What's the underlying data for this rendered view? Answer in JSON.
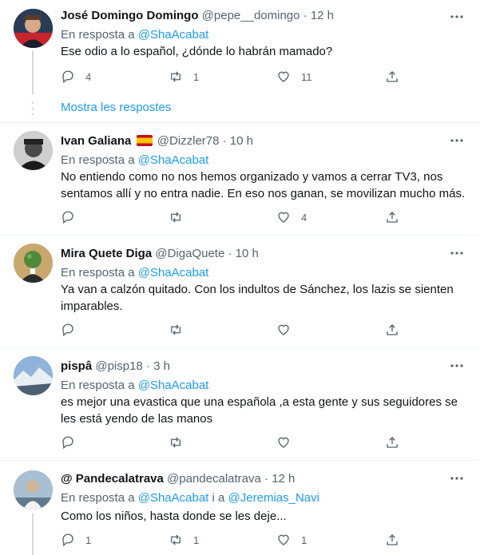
{
  "colors": {
    "link": "#1d9bf0",
    "muted": "#536471",
    "text": "#0f1419",
    "divider": "#eff3f4"
  },
  "show_replies_label": "Mostra les respostes",
  "tweets": [
    {
      "name": "José Domingo Domingo",
      "handle": "@pepe__domingo",
      "time": "· 12 h",
      "reply_prefix": "En resposta a",
      "reply_to": "@ShaAcabat",
      "reply_extra": "",
      "reply_to2": "",
      "text": "Ese odio a lo español, ¿dónde lo habrán mamado?",
      "replies": "4",
      "retweets": "1",
      "likes": "11",
      "avatar_icon": "avatar-photo-man-red"
    },
    {
      "name": "Ivan Galiana",
      "flag": "spain-flag-emoji",
      "handle": "@Dizzler78",
      "time": "· 10 h",
      "reply_prefix": "En resposta a",
      "reply_to": "@ShaAcabat",
      "text": "No entiendo como no nos hemos organizado y vamos a cerrar TV3, nos sentamos allí y no entra nadie. En eso nos ganan, se movilizan mucho más.",
      "replies": "",
      "retweets": "",
      "likes": "4",
      "avatar_icon": "avatar-photo-man-bw"
    },
    {
      "name": "Mira Quete Diga",
      "handle": "@DigaQuete",
      "time": "· 10 h",
      "reply_prefix": "En resposta a",
      "reply_to": "@ShaAcabat",
      "text": "Ya van a calzón quitado. Con los indultos de Sánchez, los lazis se sienten imparables.",
      "replies": "",
      "retweets": "",
      "likes": "",
      "avatar_icon": "avatar-apple-man"
    },
    {
      "name": "pispâ",
      "handle": "@pisp18",
      "time": "· 3 h",
      "reply_prefix": "En resposta a",
      "reply_to": "@ShaAcabat",
      "text": "es mejor una evastica que una española ,a esta gente y sus seguidores se les está yendo de las manos",
      "replies": "",
      "retweets": "",
      "likes": "",
      "avatar_icon": "avatar-mountains"
    },
    {
      "name": "@ Pandecalatrava",
      "handle": "@pandecalatrava",
      "time": "· 12 h",
      "reply_prefix": "En resposta a",
      "reply_to": "@ShaAcabat",
      "reply_mid": "i a",
      "reply_to2": "@Jeremias_Navi",
      "text": "Como los niños, hasta donde se les deje...",
      "replies": "1",
      "retweets": "1",
      "likes": "1",
      "avatar_icon": "avatar-photo-person"
    }
  ]
}
